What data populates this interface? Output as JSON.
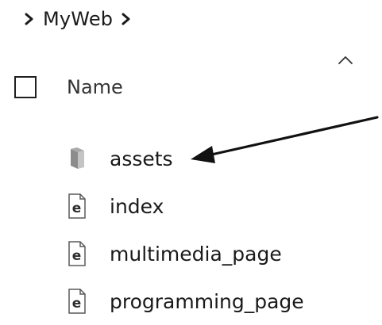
{
  "breadcrumb": {
    "root_chevron_icon": "chevron-right-icon",
    "folder": "MyWeb",
    "trailing_chevron_icon": "chevron-right-icon"
  },
  "header": {
    "sort_icon": "caret-up-icon",
    "column_name": "Name"
  },
  "files": [
    {
      "name": "assets",
      "icon": "folder-icon",
      "type": "folder"
    },
    {
      "name": "index",
      "icon": "html-file-icon",
      "type": "file"
    },
    {
      "name": "multimedia_page",
      "icon": "html-file-icon",
      "type": "file"
    },
    {
      "name": "programming_page",
      "icon": "html-file-icon",
      "type": "file"
    }
  ],
  "colors": {
    "text": "#1a1a1a",
    "folder": "#a9a9a9",
    "arrow": "#111111"
  }
}
